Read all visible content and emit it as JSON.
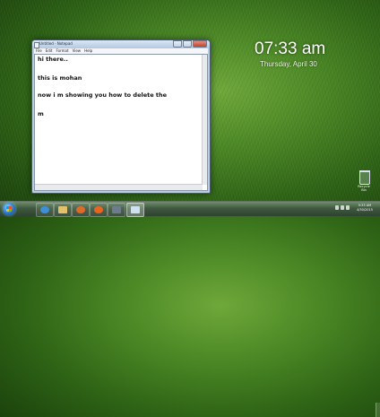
{
  "desktop": {
    "clock_time": "07:33 am",
    "clock_date": "Thursday, April 30",
    "recycle_bin_label": "Recycle Bin"
  },
  "notepad": {
    "title": "Untitled - Notepad",
    "menu": [
      "File",
      "Edit",
      "Format",
      "View",
      "Help"
    ],
    "lines": [
      "hi there..",
      "this is mohan",
      "now i m showing you how to delete the",
      "m"
    ]
  },
  "taskbar": {
    "pinned": [
      {
        "icon": "internet-explorer-icon",
        "color": "#3d8fd6"
      },
      {
        "icon": "file-explorer-icon",
        "color": "#e2c16a"
      },
      {
        "icon": "media-player-icon",
        "color": "#e06a2a"
      },
      {
        "icon": "firefox-icon",
        "color": "#e8641f"
      },
      {
        "icon": "media-icon",
        "color": "#6c7c8c"
      },
      {
        "icon": "notepad-icon",
        "color": "#cfe0f0"
      }
    ],
    "tray_time": "5:33 AM",
    "tray_date": "4/30/2015"
  }
}
